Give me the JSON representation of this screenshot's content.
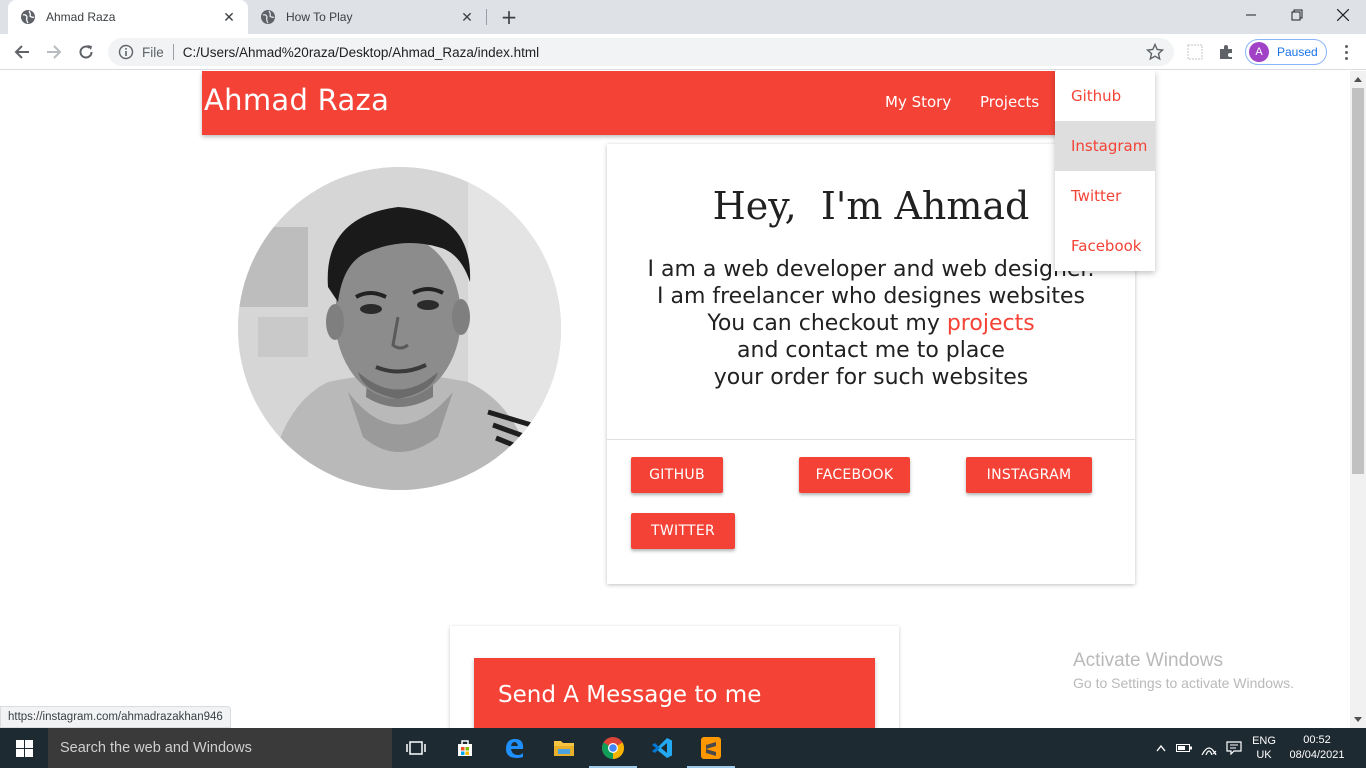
{
  "browser": {
    "tabs": [
      {
        "title": "Ahmad Raza",
        "active": true
      },
      {
        "title": "How To Play",
        "active": false
      }
    ],
    "omnibox": {
      "scheme_label": "File",
      "url": "C:/Users/Ahmad%20raza/Desktop/Ahmad_Raza/index.html"
    },
    "profile": {
      "initial": "A",
      "status": "Paused"
    },
    "status_url": "https://instagram.com/ahmadrazakhan946"
  },
  "page": {
    "navbar": {
      "brand": "Ahmad Raza",
      "links": [
        "My Story",
        "Projects"
      ]
    },
    "dropdown": {
      "items": [
        "Github",
        "Instagram",
        "Twitter",
        "Facebook"
      ],
      "highlighted": "Instagram"
    },
    "intro": {
      "title": "Hey,  I'm Ahmad",
      "lines": [
        "I am a web developer and web designer.",
        "I am freelancer who designes websites",
        "You can checkout my",
        "and contact me to place",
        "your order for such websites"
      ],
      "projects_link": "projects"
    },
    "social_buttons": [
      "GITHUB",
      "FACEBOOK",
      "INSTAGRAM",
      "TWITTER"
    ],
    "message_card": {
      "title": "Send A Message to me"
    },
    "accent_color": "#f44336"
  },
  "watermark": {
    "line1": "Activate Windows",
    "line2": "Go to Settings to activate Windows."
  },
  "taskbar": {
    "search_placeholder": "Search the web and Windows",
    "language": {
      "top": "ENG",
      "bottom": "UK"
    },
    "time": "00:52",
    "date": "08/04/2021"
  }
}
